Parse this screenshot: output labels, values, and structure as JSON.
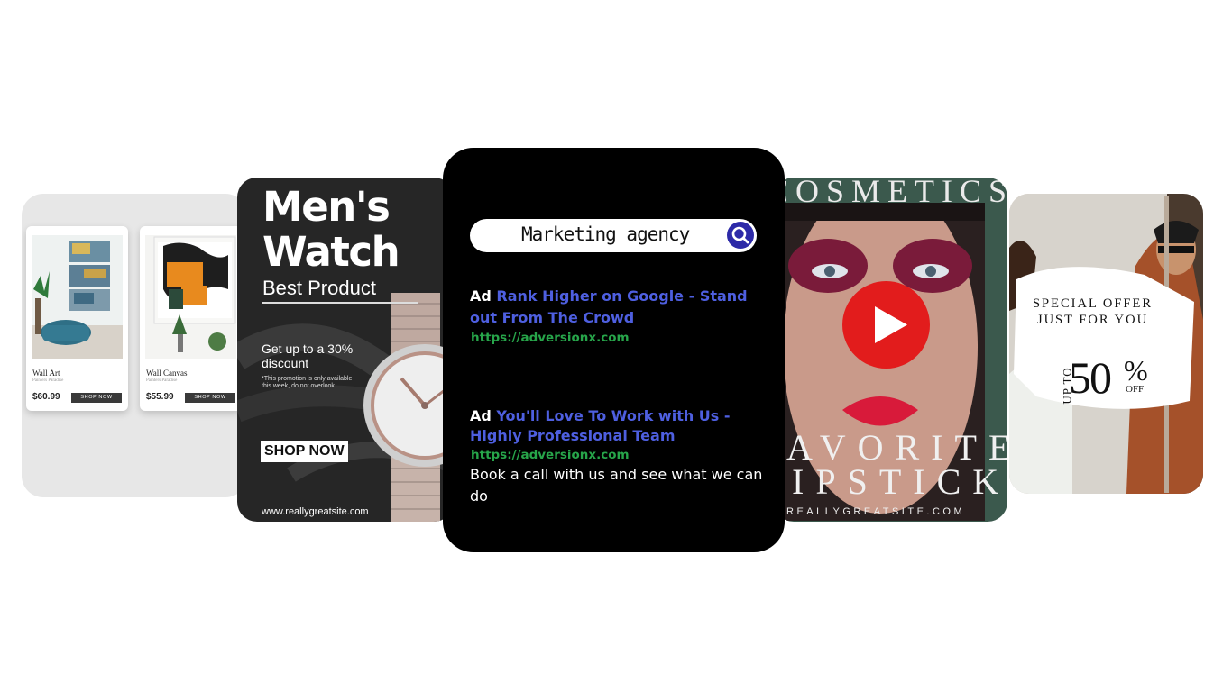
{
  "shop_card": {
    "products": [
      {
        "name": "Wall Art",
        "store": "Painters Paradise",
        "price": "$60.99",
        "button": "SHOP NOW"
      },
      {
        "name": "Wall Canvas",
        "store": "Painters Paradise",
        "price": "$55.99",
        "button": "SHOP NOW"
      }
    ]
  },
  "watch_card": {
    "title_line1": "Men's",
    "title_line2": "Watch",
    "subtitle": "Best Product",
    "discount": "Get up to a 30% discount",
    "fine_print": "*This promotion is only available this week, do not overlook",
    "button": "SHOP NOW",
    "site": "www.reallygreatsite.com"
  },
  "search_card": {
    "query": "Marketing agency",
    "ads": [
      {
        "label": "Ad",
        "title": "Rank Higher on Google - Stand out From The Crowd",
        "url": "https://adversionx.com",
        "description": ""
      },
      {
        "label": "Ad",
        "title": "You'll Love To Work with Us - Highly Professional Team",
        "url": "https://adversionx.com",
        "description": "Book a call with us and see what we can do"
      }
    ]
  },
  "cosmetics_card": {
    "brand": "COSMETICS",
    "line1": "AVORITE",
    "line2": "IPSTICKS",
    "site": "REALLYGREATSITE.COM"
  },
  "offer_card": {
    "line1": "SPECIAL OFFER",
    "line2": "JUST FOR YOU",
    "upto": "UP TO",
    "amount": "50",
    "percent": "%",
    "off": "OFF"
  },
  "colors": {
    "ad_title": "#4e5fe0",
    "ad_url": "#27a54a",
    "search_button": "#2d2aa8",
    "play_button": "#e21c1c",
    "cosmetics_bg": "#3b594d"
  }
}
